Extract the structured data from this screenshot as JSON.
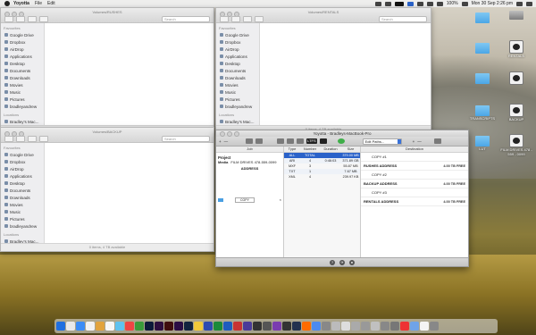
{
  "menubar": {
    "app_name": "Yoyotta",
    "menus": [
      "File",
      "Edit"
    ],
    "battery": "100%",
    "datetime": "Mon 30 Sep 2:26 pm"
  },
  "finder_windows": [
    {
      "title": "Volumes/RUSHES",
      "search_placeholder": "Search",
      "status": "0 items, 4 TB available",
      "favourites_label": "Favourites",
      "locations_label": "Locations",
      "favourites": [
        "Google Drive",
        "Dropbox",
        "AirDrop",
        "Applications",
        "Desktop",
        "Documents",
        "Downloads",
        "Movies",
        "Music",
        "Pictures",
        "bradleyandrew"
      ],
      "locations": [
        "Bradley's Mac..."
      ]
    },
    {
      "title": "Volumes/RENTALS",
      "search_placeholder": "Search",
      "status": "0 items, 4 TB available",
      "favourites_label": "Favourites",
      "locations_label": "Locations",
      "favourites": [
        "Google Drive",
        "Dropbox",
        "AirDrop",
        "Applications",
        "Desktop",
        "Documents",
        "Downloads",
        "Movies",
        "Music",
        "Pictures",
        "bradleyandrew"
      ],
      "locations": [
        "Bradley's Mac..."
      ]
    },
    {
      "title": "Volumes/BACKUP",
      "search_placeholder": "Search",
      "status": "0 items, 4 TB available",
      "favourites_label": "Favourites",
      "locations_label": "Locations",
      "favourites": [
        "Google Drive",
        "Dropbox",
        "AirDrop",
        "Applications",
        "Desktop",
        "Documents",
        "Downloads",
        "Movies",
        "Music",
        "Pictures",
        "bradleyandrew"
      ],
      "locations": [
        "Bradley's Mac..."
      ]
    }
  ],
  "yoyotta": {
    "title": "Yoyotta - Bradleys-MacBook-Pro",
    "toolbar": {
      "add": "+",
      "remove": "—",
      "lto": "LTFS",
      "dropdown": "Edit Paths...",
      "add2": "+",
      "remove2": "—"
    },
    "left": {
      "header": "Job",
      "project_label": "Project",
      "media_label": "Media",
      "media_value": "FILM DRIVES 478-559-0099",
      "address": "ADDRESS",
      "copy_button": "COPY",
      "copy_x": "×"
    },
    "table": {
      "headers": [
        "Type",
        "Number",
        "Duration",
        "Size"
      ],
      "rows": [
        [
          "ALL",
          "TOTAL",
          "",
          "379.00 MB"
        ],
        [
          "ARI",
          "4",
          "0:46:03",
          "371.89 GB"
        ],
        [
          "MXF",
          "3",
          "",
          "55.87 MB"
        ],
        [
          "TXT",
          "1",
          "",
          "7.67 MB"
        ],
        [
          "XML",
          "4",
          "",
          "239.97 KB"
        ]
      ]
    },
    "destinations": {
      "header": "Destination",
      "rows": [
        {
          "text": "COPY #1",
          "free": "",
          "strong": false,
          "indent": true
        },
        {
          "text": "RUSHES ADDRESS",
          "free": "4.00 TB FREE",
          "strong": true,
          "indent": false
        },
        {
          "text": "COPY #2",
          "free": "",
          "strong": false,
          "indent": true
        },
        {
          "text": "BACKUP ADDRESS",
          "free": "4.00 TB FREE",
          "strong": true,
          "indent": false
        },
        {
          "text": "COPY #3",
          "free": "",
          "strong": false,
          "indent": true
        },
        {
          "text": "RENTALS ADDRESS",
          "free": "4.00 TB FREE",
          "strong": true,
          "indent": false
        }
      ]
    },
    "bottom": {
      "help": "?",
      "b2": "✈",
      "b3": "●"
    }
  },
  "desktop_icons": [
    {
      "label": "",
      "kind": "folder"
    },
    {
      "label": "",
      "kind": "ssd"
    },
    {
      "label": "",
      "kind": "folder"
    },
    {
      "label": "RENTALS",
      "kind": "disk"
    },
    {
      "label": "",
      "kind": "folder"
    },
    {
      "label": "",
      "kind": "disk"
    },
    {
      "label": "TRANSCRIPTS",
      "kind": "folder"
    },
    {
      "label": "BACKUP",
      "kind": "disk"
    },
    {
      "label": "LUT",
      "kind": "folder"
    },
    {
      "label": "FILM DRIVES 478 - 559 - 0099",
      "kind": "disk"
    }
  ],
  "dock": {
    "colors": [
      "#1f6fe0",
      "#e9e9e9",
      "#3b8cf6",
      "#f2f2f2",
      "#e2a33c",
      "#f7f7f7",
      "#5ec2f0",
      "#e44",
      "#3a9b3a",
      "#0d1a3a",
      "#2d0f3f",
      "#3f0e0e",
      "#2b0d44",
      "#12233f",
      "#f0c93a",
      "#2d4bb0",
      "#1b8a3a",
      "#1e5cbf",
      "#c83333",
      "#4b3b9a",
      "#333",
      "#555",
      "#7a3bb0",
      "#333",
      "#24324f",
      "#ff6b00",
      "#4b8af0",
      "#888",
      "#bbb",
      "#ddd",
      "#aaa",
      "#999",
      "#c0c0c0",
      "#888",
      "#777",
      "#e33",
      "#6fa3e8",
      "#f4f4f4",
      "#888"
    ]
  }
}
